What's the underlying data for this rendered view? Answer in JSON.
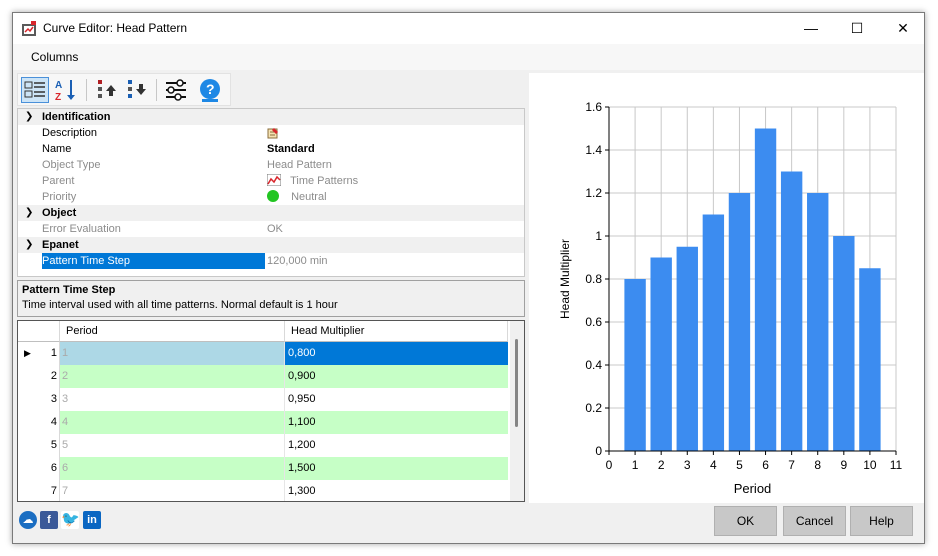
{
  "window": {
    "title": "Curve Editor: Head Pattern",
    "minimize": "—",
    "maximize": "☐",
    "close": "✕"
  },
  "menu": {
    "columns": "Columns"
  },
  "toolbar": {
    "buttons": [
      "categorized-view-icon",
      "sort-az-icon",
      "move-up-icon",
      "move-down-icon",
      "settings-sliders-icon",
      "help-icon"
    ]
  },
  "properties": {
    "categories": {
      "identification": "Identification",
      "object": "Object",
      "epanet": "Epanet"
    },
    "rows": {
      "description": {
        "label": "Description",
        "value": ""
      },
      "name": {
        "label": "Name",
        "value": "Standard"
      },
      "object_type": {
        "label": "Object Type",
        "value": "Head Pattern"
      },
      "parent": {
        "label": "Parent",
        "value": "Time Patterns"
      },
      "priority": {
        "label": "Priority",
        "value": "Neutral"
      },
      "error_evaluation": {
        "label": "Error Evaluation",
        "value": "OK"
      },
      "pattern_time_step": {
        "label": "Pattern Time Step",
        "value": "120,000 min"
      }
    },
    "priority_color": "#22c522"
  },
  "description_panel": {
    "title": "Pattern Time Step",
    "text": "Time interval used with all time patterns. Normal default is 1 hour"
  },
  "grid": {
    "headers": {
      "period": "Period",
      "head_multiplier": "Head Multiplier"
    },
    "rows": [
      {
        "row": "1",
        "period": "1",
        "value": "0,800"
      },
      {
        "row": "2",
        "period": "2",
        "value": "0,900"
      },
      {
        "row": "3",
        "period": "3",
        "value": "0,950"
      },
      {
        "row": "4",
        "period": "4",
        "value": "1,100"
      },
      {
        "row": "5",
        "period": "5",
        "value": "1,200"
      },
      {
        "row": "6",
        "period": "6",
        "value": "1,500"
      },
      {
        "row": "7",
        "period": "7",
        "value": "1,300"
      }
    ]
  },
  "buttons": {
    "ok": "OK",
    "cancel": "Cancel",
    "help": "Help"
  },
  "chart_data": {
    "type": "bar",
    "x": [
      1,
      2,
      3,
      4,
      5,
      6,
      7,
      8,
      9,
      10
    ],
    "values": [
      0.8,
      0.9,
      0.95,
      1.1,
      1.2,
      1.5,
      1.3,
      1.2,
      1.0,
      0.85
    ],
    "xlabel": "Period",
    "ylabel": "Head Multiplier",
    "xlim": [
      0,
      11
    ],
    "ylim": [
      0,
      1.6
    ],
    "xticks": [
      "0",
      "1",
      "2",
      "3",
      "4",
      "5",
      "6",
      "7",
      "8",
      "9",
      "10",
      "11"
    ],
    "yticks": [
      "0",
      "0.2",
      "0.4",
      "0.6",
      "0.8",
      "1",
      "1.2",
      "1.4",
      "1.6"
    ],
    "grid": true,
    "bar_color": "#3c8cf0"
  }
}
